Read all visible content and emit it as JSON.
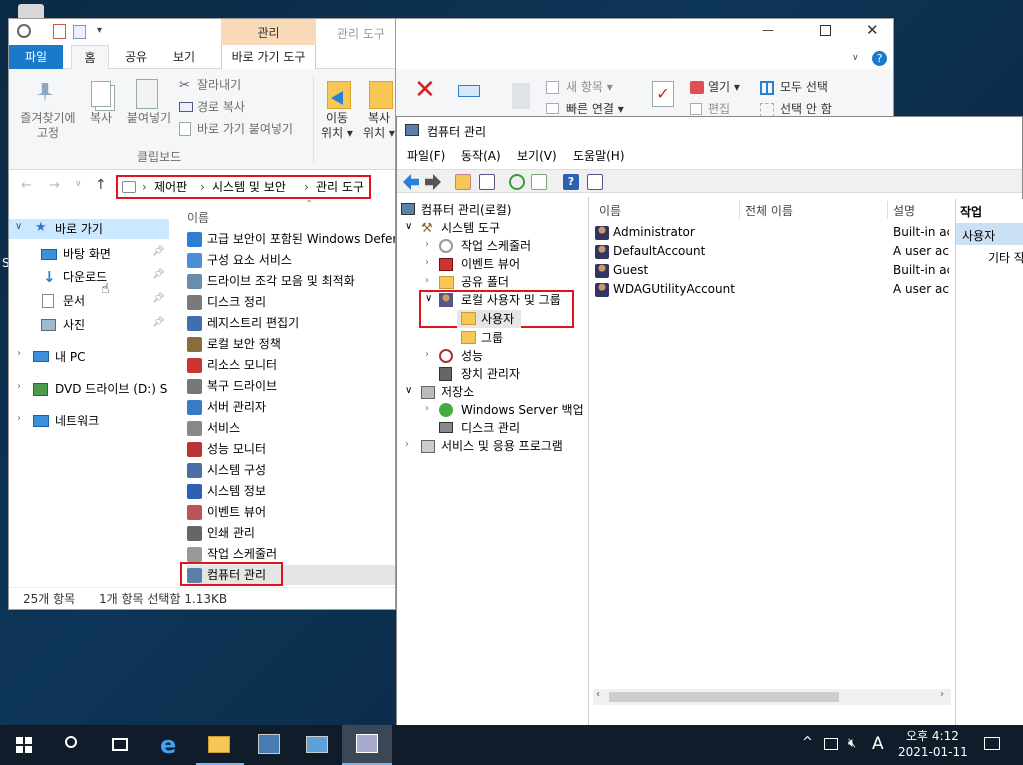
{
  "explorer": {
    "context_header": "관리",
    "title": "관리 도구",
    "tabs": [
      "파일",
      "홈",
      "공유",
      "보기",
      "바로 가기 도구"
    ],
    "ribbon": {
      "pin_label": "즐겨찾기에\n고정",
      "copy_label": "복사",
      "paste_label": "붙여넣기",
      "cut_label": "잘라내기",
      "copy_path_label": "경로 복사",
      "paste_shortcut_label": "바로 가기 붙여넣기",
      "clipboard_group": "클립보드",
      "move_label": "이동\n위치 ▾",
      "copy_to_label": "복사\n위치 ▾",
      "new_item_label": "새 항목 ▾",
      "easy_access_label": "빠른 연결 ▾",
      "open_label": "열기 ▾",
      "edit_label": "편집",
      "select_all_label": "모두 선택",
      "select_none_label": "선택 안 함"
    },
    "breadcrumb": [
      "제어판",
      "시스템 및 보안",
      "관리 도구"
    ],
    "nav": {
      "quick_access": "바로 가기",
      "items": [
        "바탕 화면",
        "다운로드",
        "문서",
        "사진"
      ],
      "this_pc": "내 PC",
      "dvd": "DVD 드라이브 (D:) S",
      "network": "네트워크"
    },
    "column_name": "이름",
    "files": [
      "고급 보안이 포함된 Windows Defender",
      "구성 요소 서비스",
      "드라이브 조각 모음 및 최적화",
      "디스크 정리",
      "레지스트리 편집기",
      "로컬 보안 정책",
      "리소스 모니터",
      "복구 드라이브",
      "서버 관리자",
      "서비스",
      "성능 모니터",
      "시스템 구성",
      "시스템 정보",
      "이벤트 뷰어",
      "인쇄 관리",
      "작업 스케줄러",
      "컴퓨터 관리"
    ],
    "status_count": "25개 항목",
    "status_selected": "1개 항목 선택함 1.13KB"
  },
  "compmgmt": {
    "title": "컴퓨터 관리",
    "menu": [
      "파일(F)",
      "동작(A)",
      "보기(V)",
      "도움말(H)"
    ],
    "tree": {
      "root": "컴퓨터 관리(로컬)",
      "system_tools": "시스템 도구",
      "task_scheduler": "작업 스케줄러",
      "event_viewer": "이벤트 뷰어",
      "shared_folders": "공유 폴더",
      "local_users": "로컬 사용자 및 그룹",
      "users": "사용자",
      "groups": "그룹",
      "performance": "성능",
      "device_manager": "장치 관리자",
      "storage": "저장소",
      "wsb": "Windows Server 백업",
      "disk_mgmt": "디스크 관리",
      "services_apps": "서비스 및 응용 프로그램"
    },
    "columns": [
      "이름",
      "전체 이름",
      "설명"
    ],
    "users": [
      {
        "name": "Administrator",
        "full": "",
        "desc": "Built-in acc"
      },
      {
        "name": "DefaultAccount",
        "full": "",
        "desc": "A user acc"
      },
      {
        "name": "Guest",
        "full": "",
        "desc": "Built-in acc"
      },
      {
        "name": "WDAGUtilityAccount",
        "full": "",
        "desc": "A user acc"
      }
    ],
    "actions_header": "작업",
    "actions_selected": "사용자",
    "actions_more": "기타 작"
  },
  "taskbar": {
    "time": "오후 4:12",
    "date": "2021-01-11",
    "ime": "A"
  },
  "colors": {
    "accent": "#1979ca",
    "highlight_red": "#e0141e",
    "selection": "#cce8ff"
  }
}
